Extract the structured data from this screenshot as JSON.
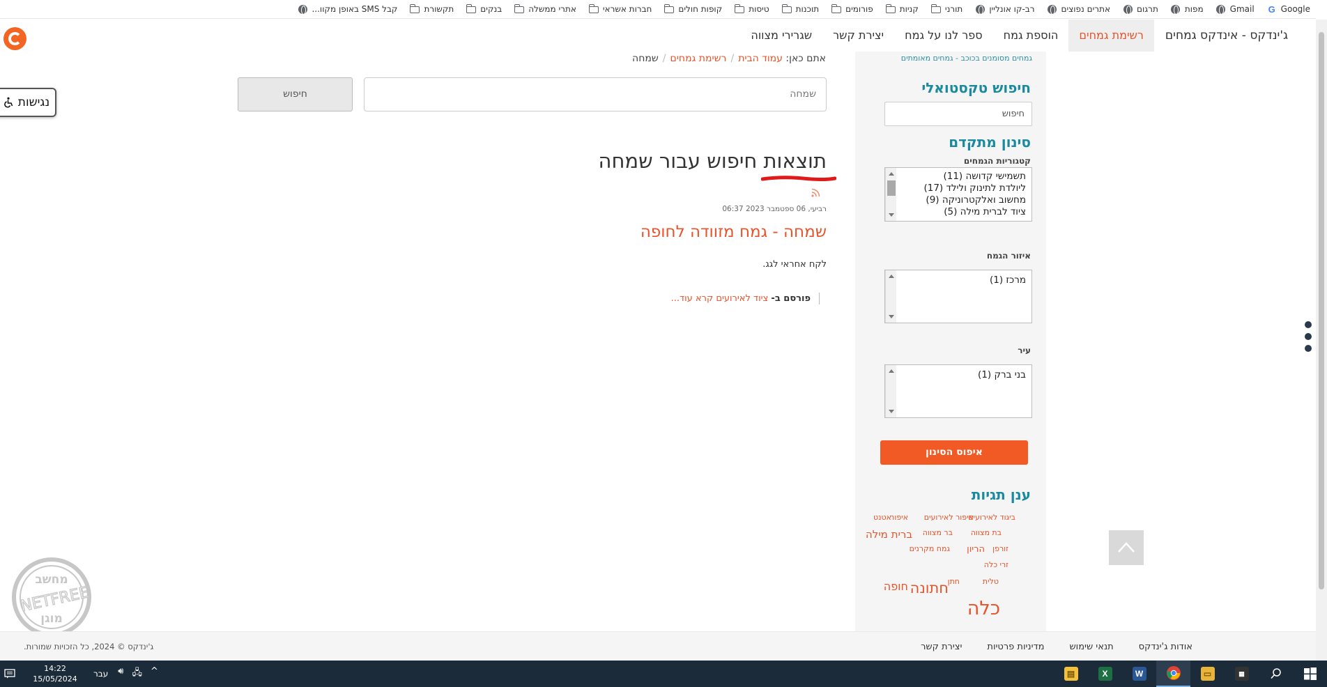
{
  "bookmarks": [
    {
      "label": "Google",
      "icon": "google-icon"
    },
    {
      "label": "Gmail",
      "icon": "globe-icon"
    },
    {
      "label": "מפות",
      "icon": "globe-icon"
    },
    {
      "label": "תרגום",
      "icon": "globe-icon"
    },
    {
      "label": "אתרים נפוצים",
      "icon": "globe-icon"
    },
    {
      "label": "רב-קו אונליין",
      "icon": "globe-icon"
    },
    {
      "label": "תורני",
      "icon": "folder-icon"
    },
    {
      "label": "קניות",
      "icon": "folder-icon"
    },
    {
      "label": "פורומים",
      "icon": "folder-icon"
    },
    {
      "label": "תוכנות",
      "icon": "folder-icon"
    },
    {
      "label": "טיסות",
      "icon": "folder-icon"
    },
    {
      "label": "קופות חולים",
      "icon": "folder-icon"
    },
    {
      "label": "חברות אשראי",
      "icon": "folder-icon"
    },
    {
      "label": "אתרי ממשלה",
      "icon": "folder-icon"
    },
    {
      "label": "בנקים",
      "icon": "folder-icon"
    },
    {
      "label": "תקשורת",
      "icon": "folder-icon"
    },
    {
      "label": "קבל SMS באופן מקוו...",
      "icon": "globe-icon"
    }
  ],
  "nav": {
    "brand": "ג'ינדקס - אינדקס גמחים",
    "items": [
      "רשימת גמחים",
      "הוספת גמח",
      "ספר לנו על גמח",
      "יצירת קשר",
      "שגרירי מצווה"
    ]
  },
  "accessibility": {
    "label": "נגישות"
  },
  "sidebar": {
    "tagline": "גמחים מסומנים בכוכב - גמחים מאומתים",
    "text_search_title": "חיפוש טקסטואלי",
    "text_search_placeholder": "חיפוש",
    "advanced_title": "סינון מתקדם",
    "categories_label": "קטגוריות הגמחים",
    "categories": [
      "תשמישי קדושה (11)",
      "ליולדת לתינוק ולילד (17)",
      "מחשוב ואלקטרוניקה (9)",
      "ציוד לברית מילה (5)"
    ],
    "region_label": "איזור הגמח",
    "regions": [
      "מרכז (1)"
    ],
    "city_label": "עיר",
    "cities": [
      "בני ברק (1)"
    ],
    "reset_label": "איפוס הסינון",
    "tags_title": "ענן תגיות",
    "tags": [
      {
        "text": "ביגוד לאירועים"
      },
      {
        "text": "איפור לאירועים"
      },
      {
        "text": "איפור"
      },
      {
        "text": "אטנט"
      },
      {
        "text": "בת מצווה"
      },
      {
        "text": "בר מצווה"
      },
      {
        "text": "ברית מילה"
      },
      {
        "text": "זורפן"
      },
      {
        "text": "הריון"
      },
      {
        "text": "גמח מקרנים"
      },
      {
        "text": "זרי כלה"
      },
      {
        "text": "טלית"
      },
      {
        "text": "חתן"
      },
      {
        "text": "חתונה"
      },
      {
        "text": "חופה"
      },
      {
        "text": "כלה"
      }
    ]
  },
  "breadcrumb": {
    "prefix": "אתם כאן:",
    "home": "עמוד הבית",
    "list": "רשימת גמחים",
    "current": "שמחה"
  },
  "search": {
    "value": "שמחה",
    "button": "חיפוש"
  },
  "results": {
    "title": "תוצאות חיפוש עבור שמחה"
  },
  "post": {
    "date": "רביעי, 06 ספטמבר 2023 06:37",
    "title": "שמחה - גמח מזוודה לחופה",
    "excerpt": "לקח אחראי לגג.",
    "posted_in_label": "פורסם ב-",
    "category": "ציוד לאירועים",
    "read_more": "קרא עוד..."
  },
  "footer": {
    "links": [
      "אודות ג'ינדקס",
      "תנאי שימוש",
      "מדיניות פרטיות",
      "יצירת קשר"
    ],
    "copyright": "ג'ינדקס © 2024, כל הזכויות שמורות."
  },
  "watermark": {
    "line1": "מחשב",
    "line2": "NETFREE",
    "line3": "מוגן"
  },
  "taskbar": {
    "time": "14:22",
    "date": "15/05/2024",
    "language": "עבר"
  },
  "colors": {
    "accent": "#e8532a",
    "teal": "#1b8aa0",
    "reset": "#f15a24",
    "taskbar": "#1c2b3a"
  }
}
